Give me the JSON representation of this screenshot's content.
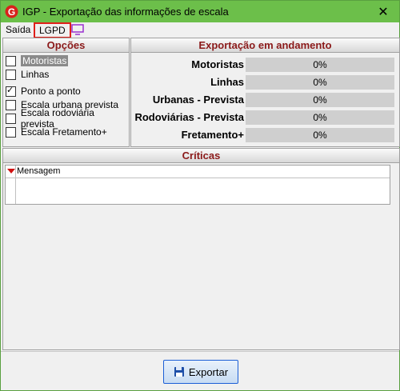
{
  "window": {
    "title": "IGP - Exportação das informações de escala"
  },
  "menu": {
    "items": [
      "Saída",
      "LGPD"
    ]
  },
  "opcoes": {
    "header": "Opções",
    "items": [
      {
        "label": "Motoristas",
        "checked": false,
        "selected": true
      },
      {
        "label": "Linhas",
        "checked": false,
        "selected": false
      },
      {
        "label": "Ponto a ponto",
        "checked": true,
        "selected": false
      },
      {
        "label": "Escala urbana prevista",
        "checked": false,
        "selected": false
      },
      {
        "label": "Escala rodoviária prevista",
        "checked": false,
        "selected": false
      },
      {
        "label": "Escala Fretamento+",
        "checked": false,
        "selected": false
      }
    ]
  },
  "exportacao": {
    "header": "Exportação em andamento",
    "rows": [
      {
        "label": "Motoristas",
        "value": "0%"
      },
      {
        "label": "Linhas",
        "value": "0%"
      },
      {
        "label": "Urbanas - Prevista",
        "value": "0%"
      },
      {
        "label": "Rodoviárias - Prevista",
        "value": "0%"
      },
      {
        "label": "Fretamento+",
        "value": "0%"
      }
    ]
  },
  "criticas": {
    "header": "Críticas",
    "column": "Mensagem"
  },
  "footer": {
    "export_label": "Exportar"
  },
  "colors": {
    "titlebar": "#6cbf4a",
    "header_text": "#8b1a1a",
    "lgpd_border": "#e0201a"
  }
}
